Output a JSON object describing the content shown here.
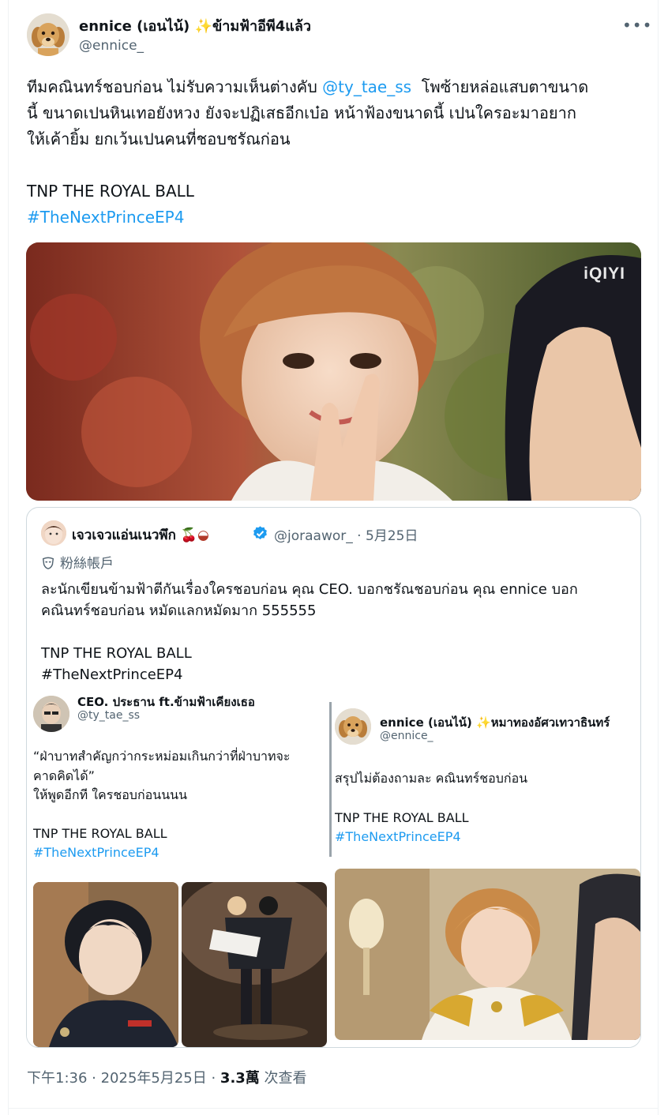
{
  "author": {
    "name": "ennice (เอนไน้)",
    "name_suffix": "ข้ามฟ้าอีพี4แล้ว",
    "handle": "@ennice_"
  },
  "tweet": {
    "text_line1_prefix": "ทีมคณินทร์ชอบก่อน ไม่รับความเห็นต่างคับ ",
    "mention": "@ty_tae_ss",
    "text_line1_suffix": "  โพซ้ายหล่อแสบตาขนาด",
    "text_line2": "นี้ ขนาดเปนหินเทอยังหวง ยังจะปฏิเสธอีกเบ๋อ หน้าฟ้องขนาดนี้ เปนใครอะมาอยาก",
    "text_line3": "ให้เค้ายิ้ม ยกเว้นเปนคนที่ชอบชรัณก่อน",
    "title": "TNP THE ROYAL BALL",
    "hashtag": "#TheNextPrinceEP4",
    "watermark": "iQIYI"
  },
  "quote": {
    "name": "เจวเจวแอ่นเนวพึก",
    "handle_date": "@joraawor_ · 5月25日",
    "community": "粉絲帳戶",
    "line1": "ละนักเขียนข้ามฟ้าตีกันเรื่องใครชอบก่อน คุณ CEO. บอกชรัณชอบก่อน คุณ ennice บอก",
    "line2": "คณินทร์ชอบก่อน หมัดแลกหมัดมาก 555555",
    "title": "TNP THE ROYAL BALL",
    "hashtag": "#TheNextPrinceEP4"
  },
  "screenshot": {
    "left": {
      "name": "CEO. ประธาน ft.ข้ามฟ้าเคียงเธอ",
      "handle": "@ty_tae_ss",
      "line1": "“ฝ่าบาทสำคัญกว่ากระหม่อมเกินกว่าที่ฝ่าบาทจะ",
      "line2": "คาดคิดได้”",
      "line3": "ให้พูดอีกที ใครชอบก่อนนนน",
      "title": "TNP THE ROYAL BALL",
      "hashtag": "#TheNextPrinceEP4"
    },
    "right": {
      "name": "ennice (เอนไน้)",
      "name_suffix": "หมาทองอัศวเทวาธินทร์",
      "handle": "@ennice_",
      "line1": "สรุปไม่ต้องถามละ คณินทร์ชอบก่อน",
      "title": "TNP THE ROYAL BALL",
      "hashtag": "#TheNextPrinceEP4"
    }
  },
  "footer": {
    "time_date": "下午1:36 · 2025年5月25日 · ",
    "views_count": "3.3萬",
    "views_label": " 次查看"
  },
  "colors": {
    "link": "#1d9bf0",
    "secondary_text": "#536471",
    "border": "#cfd9de",
    "verified": "#1d9bf0"
  },
  "icons": [
    "sparkle-icon",
    "more-icon",
    "cherries-icon",
    "bowl-icon",
    "verified-badge-icon",
    "mask-icon"
  ]
}
